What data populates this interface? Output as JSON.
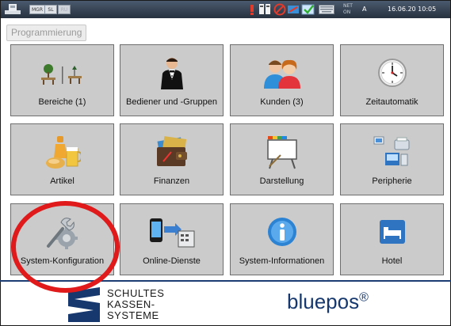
{
  "statusbar": {
    "badges": [
      "MGR",
      "SL",
      "RU"
    ],
    "net_label": "NET",
    "net_state": "ON",
    "user_letter": "A",
    "datetime": "16.06.20  10:05"
  },
  "page": {
    "title": "Programmierung"
  },
  "tiles": [
    {
      "label": "Bereiche (1)",
      "icon": "trees-icon"
    },
    {
      "label": "Bediener und -Gruppen",
      "icon": "waiter-icon"
    },
    {
      "label": "Kunden (3)",
      "icon": "customers-icon"
    },
    {
      "label": "Zeitautomatik",
      "icon": "clock-icon"
    },
    {
      "label": "Artikel",
      "icon": "food-drink-icon"
    },
    {
      "label": "Finanzen",
      "icon": "wallet-icon"
    },
    {
      "label": "Darstellung",
      "icon": "display-board-icon"
    },
    {
      "label": "Peripherie",
      "icon": "peripherals-icon"
    },
    {
      "label": "System-Konfiguration",
      "icon": "wrench-gear-icon"
    },
    {
      "label": "Online-Dienste",
      "icon": "phone-transfer-icon"
    },
    {
      "label": "System-Informationen",
      "icon": "info-icon"
    },
    {
      "label": "Hotel",
      "icon": "bed-icon"
    }
  ],
  "footer": {
    "brand_lines": [
      "SCHULTES",
      "KASSEN-",
      "SYSTEME"
    ],
    "product_name": "bluepos",
    "registered_mark": "®"
  },
  "colors": {
    "tile_bg": "#cbcbcb",
    "divider": "#1c3d73",
    "brand_blue": "#16386e",
    "highlight": "#e01a1a"
  }
}
